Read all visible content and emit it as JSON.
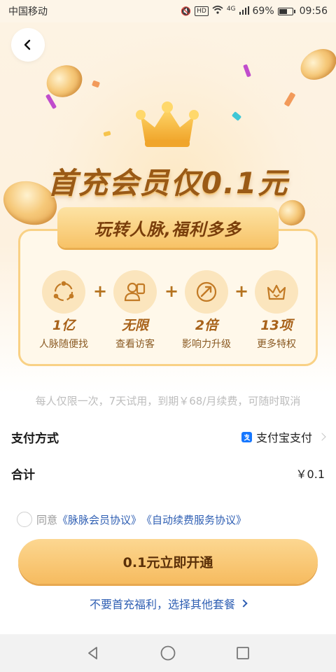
{
  "status_bar": {
    "carrier": "中国移动",
    "network": "4G",
    "battery": "69%",
    "battery_level": 0.69,
    "time": "09:56"
  },
  "hero": {
    "headline": "首充会员仅0.1元",
    "card_title": "玩转人脉,福利多多",
    "benefits": [
      {
        "value": "1亿",
        "label": "人脉随便找",
        "icon": "network-icon"
      },
      {
        "value": "无限",
        "label": "查看访客",
        "icon": "visitors-icon"
      },
      {
        "value": "2倍",
        "label": "影响力升级",
        "icon": "influence-icon"
      },
      {
        "value": "13项",
        "label": "更多特权",
        "icon": "crown-icon"
      }
    ],
    "plus": "+"
  },
  "notice": "每人仅限一次，7天试用，到期￥68/月续费，可随时取消",
  "payment": {
    "method_label": "支付方式",
    "method_value": "支付宝支付",
    "total_label": "合计",
    "total_value": "￥0.1"
  },
  "agreement": {
    "prefix": "同意",
    "link1": "《脉脉会员协议》",
    "link2": "《自动续费服务协议》"
  },
  "cta_label": "0.1元立即开通",
  "alt_link": "不要首充福利，选择其他套餐",
  "colors": {
    "accent_gold": "#f6bb5f",
    "brown_text": "#9a5a16",
    "link_blue": "#2f5fb3",
    "alipay_blue": "#1677ff"
  }
}
